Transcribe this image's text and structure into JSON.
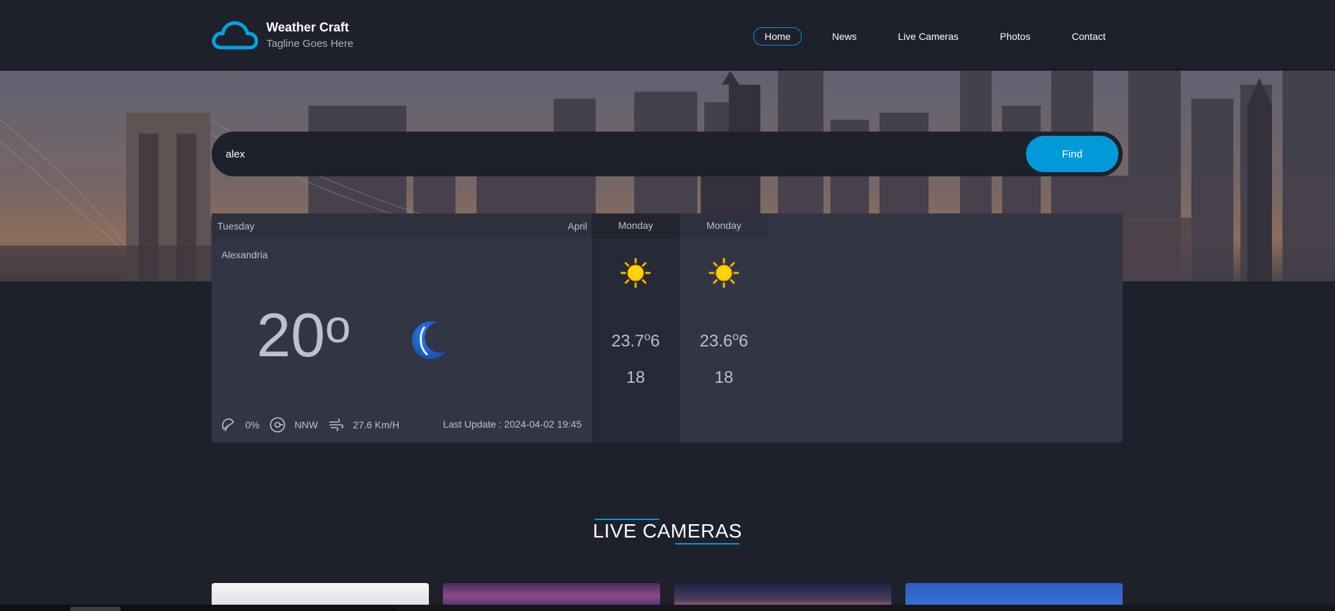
{
  "header": {
    "brand": "Weather Craft",
    "tagline": "Tagline Goes Here",
    "logo_icon": "cloud-icon",
    "nav": [
      {
        "label": "Home",
        "active": true
      },
      {
        "label": "News",
        "active": false
      },
      {
        "label": "Live Cameras",
        "active": false
      },
      {
        "label": "Photos",
        "active": false
      },
      {
        "label": "Contact",
        "active": false
      }
    ]
  },
  "search": {
    "value": "alex",
    "button_label": "Find"
  },
  "today": {
    "day": "Tuesday",
    "month": "April",
    "location": "Alexandria",
    "temp": "20",
    "degree": "o",
    "condition_icon": "moon-icon",
    "rain": "0%",
    "wind_dir": "NNW",
    "wind_speed": "27.6 Km/H",
    "last_update": "Last Update : 2024-04-02 19:45"
  },
  "forecast": [
    {
      "day": "Monday",
      "icon": "sun-icon",
      "max": "23.7",
      "degree": "o",
      "max_suffix": "6",
      "min": "18"
    },
    {
      "day": "Monday",
      "icon": "sun-icon",
      "max": "23.6",
      "degree": "o",
      "max_suffix": "6",
      "min": "18"
    }
  ],
  "live_cameras": {
    "title": "LIVE CAMERAS"
  },
  "colors": {
    "accent": "#009ad8",
    "background": "#1e202b",
    "panel": "#323544"
  }
}
